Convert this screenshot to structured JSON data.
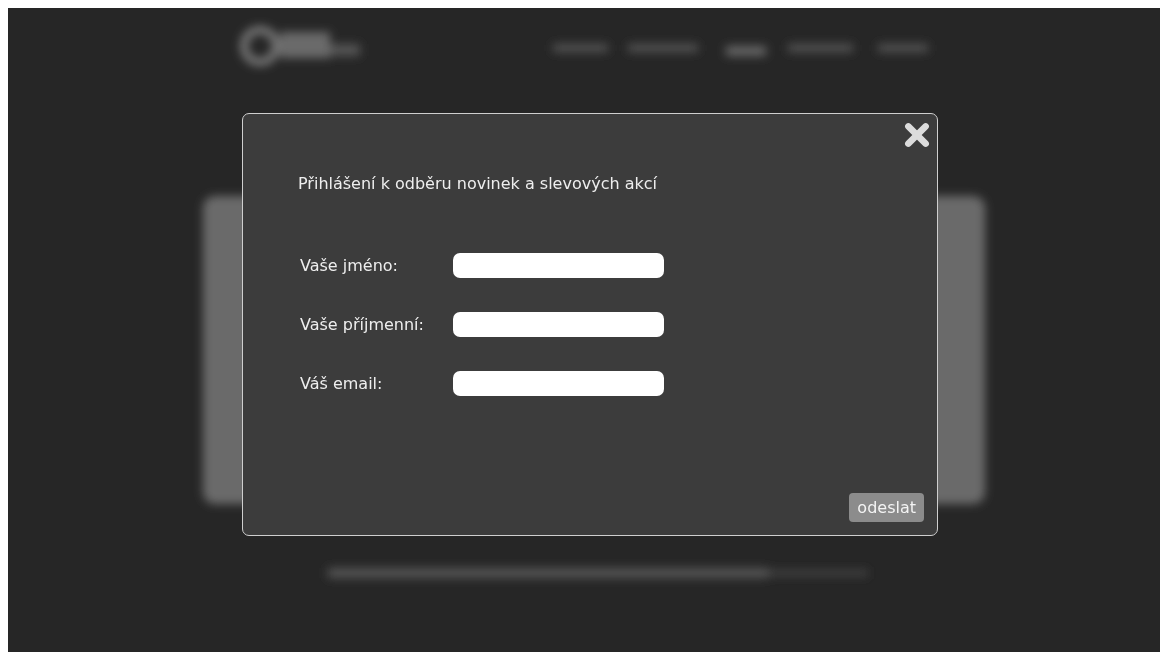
{
  "dialog": {
    "title": "Přihlášení k odběru novinek a slevových akcí",
    "fields": [
      {
        "label": "Vaše jméno:"
      },
      {
        "label": "Vaše příjmenní:"
      },
      {
        "label": "Váš email:"
      }
    ],
    "submit": "odeslat"
  }
}
